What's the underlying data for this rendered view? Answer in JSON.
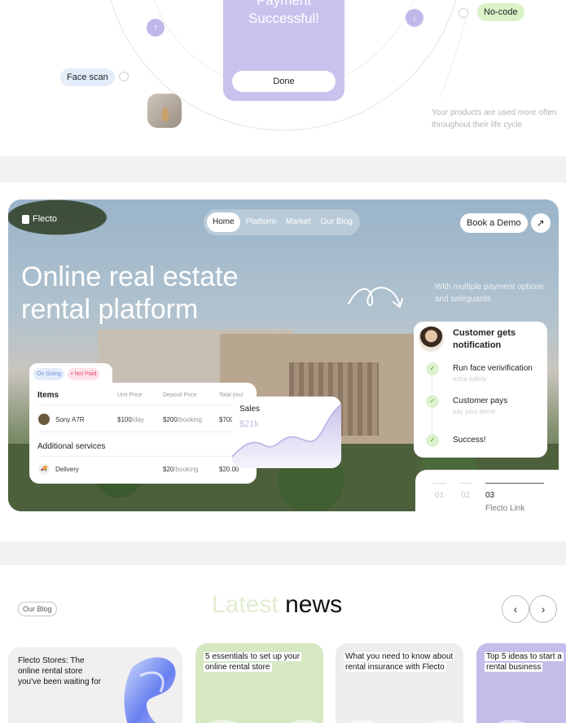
{
  "top": {
    "payment_title": "Payment\nSuccessful!",
    "done_label": "Done",
    "face_scan_label": "Face scan",
    "no_code_label": "No-code",
    "note": "Your products are used more often throughout their life cycle",
    "arrow_up": "↑",
    "arrow_down": "↓"
  },
  "hero": {
    "logo": "Flecto",
    "nav": [
      "Home",
      "Platform",
      "Market",
      "Our Blog"
    ],
    "book_demo": "Book a Demo",
    "demo_arrow": "↗",
    "title": "Online real estate\nrental platform",
    "note": "With multiple payment options and safeguards",
    "colors": {
      "accent_purple": "#c9c2ee",
      "accent_green": "#d9f2c8"
    }
  },
  "table": {
    "tags": [
      "On Going",
      "• Not Paid"
    ],
    "headers": [
      "Items",
      "Unit Price",
      "Deposit Price",
      "Total (incl"
    ],
    "rows": [
      {
        "name": "Sony A7R",
        "unit": "$100",
        "unit_suffix": "/day",
        "deposit": "$200",
        "deposit_suffix": "/booking",
        "total": "$700"
      }
    ],
    "additional_label": "Additional services",
    "services": [
      {
        "name": "Delivery",
        "deposit": "$20",
        "deposit_suffix": "/booking",
        "total": "$20.00"
      }
    ]
  },
  "sales": {
    "label": "Sales",
    "value": "$21k"
  },
  "notification": {
    "title": "Customer gets\nnotification",
    "steps": [
      {
        "title": "Run face verivification",
        "sub": "extra safety"
      },
      {
        "title": "Customer pays",
        "sub": "pay your items"
      },
      {
        "title": "Success!",
        "sub": ""
      }
    ],
    "check": "✓"
  },
  "stepper": {
    "steps": [
      "01",
      "02",
      "03"
    ],
    "active_index": 2,
    "link": "Flecto Link"
  },
  "blog": {
    "pill": "Our Blog",
    "heading_light": "Latest",
    "heading_dark": " news",
    "prev": "‹",
    "next": "›",
    "posts": [
      {
        "title": "Flecto Stores: The online rental store you've been waiting for"
      },
      {
        "title": "5 essentials to set up your online rental store"
      },
      {
        "title": "What you need to know about rental insurance with Flecto"
      },
      {
        "title": "Top 5 ideas to start a rental business"
      }
    ]
  }
}
